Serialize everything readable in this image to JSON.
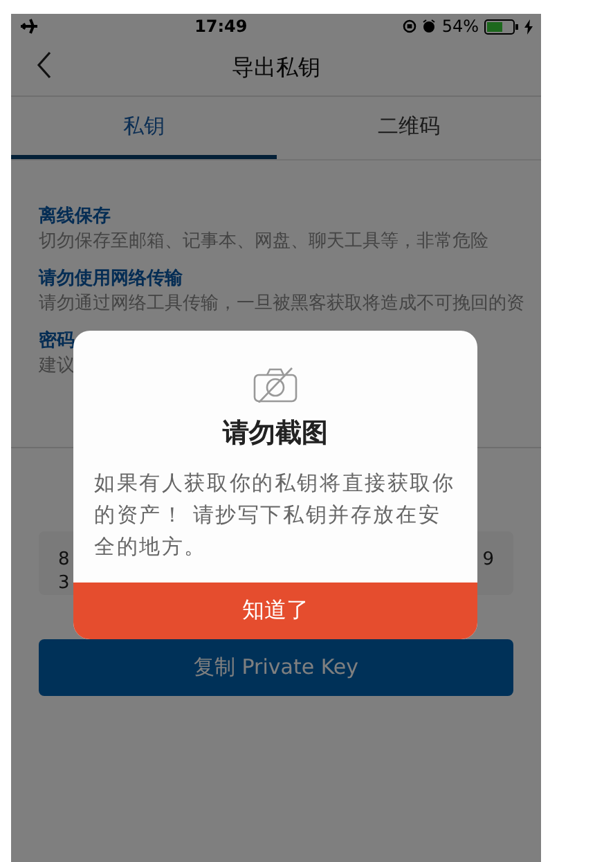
{
  "status_bar": {
    "time": "17:49",
    "battery_percent": "54%"
  },
  "nav": {
    "title": "导出私钥"
  },
  "tabs": [
    {
      "label": "私钥",
      "selected": true
    },
    {
      "label": "二维码",
      "selected": false
    }
  ],
  "sections": [
    {
      "heading": "离线保存",
      "text": "切勿保存至邮箱、记事本、网盘、聊天工具等，非常危险"
    },
    {
      "heading": "请勿使用网络传输",
      "text": "请勿通过网络工具传输，一旦被黑客获取将造成不可挽回的资"
    },
    {
      "heading": "密码",
      "text": "建议"
    }
  ],
  "private_key": {
    "line_1_start": "8",
    "line_1_end": "9",
    "line_2_start": "3"
  },
  "copy_button": "复制 Private Key",
  "dialog": {
    "title": "请勿截图",
    "message": "如果有人获取你的私钥将直接获取你的资产！ 请抄写下私钥并存放在安全的地方。",
    "button": "知道了"
  }
}
